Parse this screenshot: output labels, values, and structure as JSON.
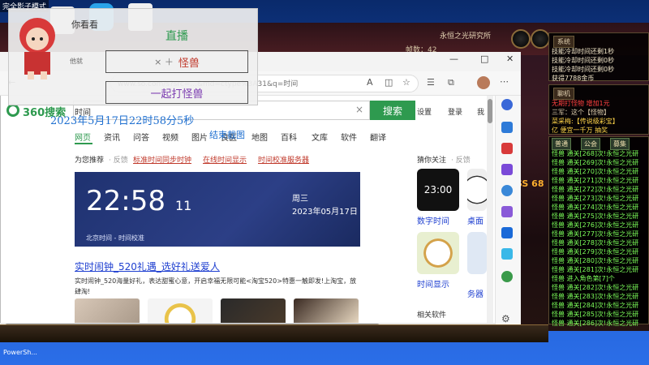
{
  "overlay": {
    "shadow_mode_label": "完全影子模式",
    "question": "你看看",
    "heading": "直播",
    "hint_small": "他就",
    "btn_monster": "怪兽",
    "btn_monster_prefix": "×  ＋",
    "btn_fight": "一起打怪兽"
  },
  "browser": {
    "url": "https://www.so.com/s?src=home&fr=none&ssid=&psid=&md=ctype%3A31&q=时间",
    "url_display": "www.so.com/s?src=...&md=ctype%3A31&q=时间",
    "logo": "360搜索",
    "search_query": "时间",
    "search_button": "搜索",
    "settings": "设置",
    "login": "登录",
    "more_top": "我",
    "page_datetime": "2023年5月17日22时58分5秒",
    "screenshot_end": "结束截图",
    "nav_tabs": [
      "网页",
      "资讯",
      "问答",
      "视频",
      "图片",
      "良医",
      "地图",
      "百科",
      "文库",
      "软件",
      "翻译"
    ],
    "recommend_label": "为您推荐",
    "feedback": "反馈",
    "rec_links": [
      "标准时间同步时钟",
      "在线时间显示",
      "时间校准服务器"
    ],
    "clock": {
      "time": "22:58",
      "seconds": "11",
      "weekday": "周三",
      "date": "2023年05月17日",
      "footer": "北京时间 - 时间校准"
    },
    "promo": {
      "title": "实时闹钟_520礼遇_选好礼送爱人",
      "desc": "实时闹钟_520海量好礼，表达甜蜜心意，开启幸福无限可能<淘宝520>特惠一触即发!上淘宝，放肆淘!"
    },
    "guess": {
      "title": "猜你关注",
      "feedback": "反馈",
      "apps": [
        {
          "label": "数字时间",
          "tile": "23:00"
        },
        {
          "label": "桌面"
        },
        {
          "label": "时间显示"
        },
        {
          "label": "务器"
        }
      ],
      "related": "相关软件"
    },
    "window_controls": [
      "—",
      "□",
      "✕"
    ]
  },
  "game": {
    "server_name": "永恒之光研究所",
    "frame_rate": "帧数：42",
    "chat_top_tab": "系统",
    "chat_top_lines": [
      "技能冷却时间还剩1秒",
      "技能冷却时间还剩0秒",
      "技能冷却时间还剩0秒",
      "获得7788金币"
    ],
    "sys_tab": "聊机",
    "sys_lines": [
      {
        "text": "无期打怪物 增加1元",
        "color": "#ff4040"
      },
      {
        "text": "三军：这个【怪物】",
        "color": "#e0d0b0"
      },
      {
        "text": "菜采梅:【传说级彩宝】",
        "color": "#ffd54a"
      },
      {
        "text": "亿 便宜一千万 抽奖",
        "color": "#ffd54a"
      }
    ],
    "chat_tabs": [
      "普通",
      "公会",
      "募集"
    ],
    "chat_lines": [
      "怪兽 通关[268]次!永恒之光研",
      "怪兽 通关[269]次!永恒之光研",
      "怪兽 通关[270]次!永恒之光研",
      "怪兽 通关[271]次!永恒之光研",
      "怪兽 通关[272]次!永恒之光研",
      "怪兽 通关[273]次!永恒之光研",
      "怪兽 通关[274]次!永恒之光研",
      "怪兽 通关[275]次!永恒之光研",
      "怪兽 通关[276]次!永恒之光研",
      "怪兽 通关[277]次!永恒之光研",
      "怪兽 通关[278]次!永恒之光研",
      "怪兽 通关[279]次!永恒之光研",
      "怪兽 通关[280]次!永恒之光研",
      "怪兽 通关[281]次!永恒之光研",
      "怪兽 进入角色第[7]个",
      "怪兽 通关[282]次!永恒之光研",
      "怪兽 通关[283]次!永恒之光研",
      "怪兽 通关[284]次!永恒之光研",
      "怪兽 通关[285]次!永恒之光研",
      "怪兽 通关[286]次!永恒之光研"
    ],
    "banner": "SS 68"
  },
  "taskbar": {
    "label": "PowerSh..."
  },
  "colors": {
    "accent_green": "#2e9a4f",
    "link_blue": "#1e3fd0",
    "red_link": "#c0392b"
  }
}
